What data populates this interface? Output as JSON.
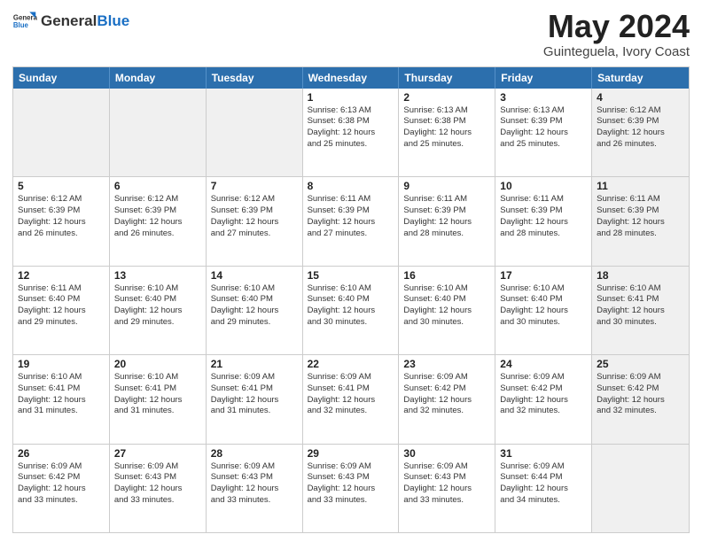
{
  "header": {
    "logo_general": "General",
    "logo_blue": "Blue",
    "month_year": "May 2024",
    "location": "Guinteguela, Ivory Coast"
  },
  "days_of_week": [
    "Sunday",
    "Monday",
    "Tuesday",
    "Wednesday",
    "Thursday",
    "Friday",
    "Saturday"
  ],
  "weeks": [
    [
      {
        "day": "",
        "info": "",
        "shaded": true,
        "empty": true
      },
      {
        "day": "",
        "info": "",
        "shaded": true,
        "empty": true
      },
      {
        "day": "",
        "info": "",
        "shaded": true,
        "empty": true
      },
      {
        "day": "1",
        "info": "Sunrise: 6:13 AM\nSunset: 6:38 PM\nDaylight: 12 hours\nand 25 minutes."
      },
      {
        "day": "2",
        "info": "Sunrise: 6:13 AM\nSunset: 6:38 PM\nDaylight: 12 hours\nand 25 minutes."
      },
      {
        "day": "3",
        "info": "Sunrise: 6:13 AM\nSunset: 6:39 PM\nDaylight: 12 hours\nand 25 minutes."
      },
      {
        "day": "4",
        "info": "Sunrise: 6:12 AM\nSunset: 6:39 PM\nDaylight: 12 hours\nand 26 minutes.",
        "shaded": true
      }
    ],
    [
      {
        "day": "5",
        "info": "Sunrise: 6:12 AM\nSunset: 6:39 PM\nDaylight: 12 hours\nand 26 minutes."
      },
      {
        "day": "6",
        "info": "Sunrise: 6:12 AM\nSunset: 6:39 PM\nDaylight: 12 hours\nand 26 minutes."
      },
      {
        "day": "7",
        "info": "Sunrise: 6:12 AM\nSunset: 6:39 PM\nDaylight: 12 hours\nand 27 minutes."
      },
      {
        "day": "8",
        "info": "Sunrise: 6:11 AM\nSunset: 6:39 PM\nDaylight: 12 hours\nand 27 minutes."
      },
      {
        "day": "9",
        "info": "Sunrise: 6:11 AM\nSunset: 6:39 PM\nDaylight: 12 hours\nand 28 minutes."
      },
      {
        "day": "10",
        "info": "Sunrise: 6:11 AM\nSunset: 6:39 PM\nDaylight: 12 hours\nand 28 minutes."
      },
      {
        "day": "11",
        "info": "Sunrise: 6:11 AM\nSunset: 6:39 PM\nDaylight: 12 hours\nand 28 minutes.",
        "shaded": true
      }
    ],
    [
      {
        "day": "12",
        "info": "Sunrise: 6:11 AM\nSunset: 6:40 PM\nDaylight: 12 hours\nand 29 minutes."
      },
      {
        "day": "13",
        "info": "Sunrise: 6:10 AM\nSunset: 6:40 PM\nDaylight: 12 hours\nand 29 minutes."
      },
      {
        "day": "14",
        "info": "Sunrise: 6:10 AM\nSunset: 6:40 PM\nDaylight: 12 hours\nand 29 minutes."
      },
      {
        "day": "15",
        "info": "Sunrise: 6:10 AM\nSunset: 6:40 PM\nDaylight: 12 hours\nand 30 minutes."
      },
      {
        "day": "16",
        "info": "Sunrise: 6:10 AM\nSunset: 6:40 PM\nDaylight: 12 hours\nand 30 minutes."
      },
      {
        "day": "17",
        "info": "Sunrise: 6:10 AM\nSunset: 6:40 PM\nDaylight: 12 hours\nand 30 minutes."
      },
      {
        "day": "18",
        "info": "Sunrise: 6:10 AM\nSunset: 6:41 PM\nDaylight: 12 hours\nand 30 minutes.",
        "shaded": true
      }
    ],
    [
      {
        "day": "19",
        "info": "Sunrise: 6:10 AM\nSunset: 6:41 PM\nDaylight: 12 hours\nand 31 minutes."
      },
      {
        "day": "20",
        "info": "Sunrise: 6:10 AM\nSunset: 6:41 PM\nDaylight: 12 hours\nand 31 minutes."
      },
      {
        "day": "21",
        "info": "Sunrise: 6:09 AM\nSunset: 6:41 PM\nDaylight: 12 hours\nand 31 minutes."
      },
      {
        "day": "22",
        "info": "Sunrise: 6:09 AM\nSunset: 6:41 PM\nDaylight: 12 hours\nand 32 minutes."
      },
      {
        "day": "23",
        "info": "Sunrise: 6:09 AM\nSunset: 6:42 PM\nDaylight: 12 hours\nand 32 minutes."
      },
      {
        "day": "24",
        "info": "Sunrise: 6:09 AM\nSunset: 6:42 PM\nDaylight: 12 hours\nand 32 minutes."
      },
      {
        "day": "25",
        "info": "Sunrise: 6:09 AM\nSunset: 6:42 PM\nDaylight: 12 hours\nand 32 minutes.",
        "shaded": true
      }
    ],
    [
      {
        "day": "26",
        "info": "Sunrise: 6:09 AM\nSunset: 6:42 PM\nDaylight: 12 hours\nand 33 minutes."
      },
      {
        "day": "27",
        "info": "Sunrise: 6:09 AM\nSunset: 6:43 PM\nDaylight: 12 hours\nand 33 minutes."
      },
      {
        "day": "28",
        "info": "Sunrise: 6:09 AM\nSunset: 6:43 PM\nDaylight: 12 hours\nand 33 minutes."
      },
      {
        "day": "29",
        "info": "Sunrise: 6:09 AM\nSunset: 6:43 PM\nDaylight: 12 hours\nand 33 minutes."
      },
      {
        "day": "30",
        "info": "Sunrise: 6:09 AM\nSunset: 6:43 PM\nDaylight: 12 hours\nand 33 minutes."
      },
      {
        "day": "31",
        "info": "Sunrise: 6:09 AM\nSunset: 6:44 PM\nDaylight: 12 hours\nand 34 minutes."
      },
      {
        "day": "",
        "info": "",
        "shaded": true,
        "empty": true
      }
    ]
  ]
}
